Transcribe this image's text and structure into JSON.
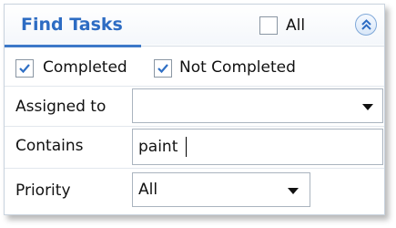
{
  "panel": {
    "title": "Find Tasks",
    "all_checkbox": {
      "label": "All",
      "checked": false
    },
    "collapse_icon": "double-chevron-up-icon"
  },
  "filters": {
    "completed": {
      "label": "Completed",
      "checked": true
    },
    "not_completed": {
      "label": "Not Completed",
      "checked": true
    }
  },
  "fields": {
    "assigned_to": {
      "label": "Assigned to",
      "value": ""
    },
    "contains": {
      "label": "Contains",
      "value": "paint"
    },
    "priority": {
      "label": "Priority",
      "value": "All"
    }
  },
  "colors": {
    "title": "#2d6cc3",
    "accent": "#3c78c8",
    "check": "#2f6fc4"
  }
}
